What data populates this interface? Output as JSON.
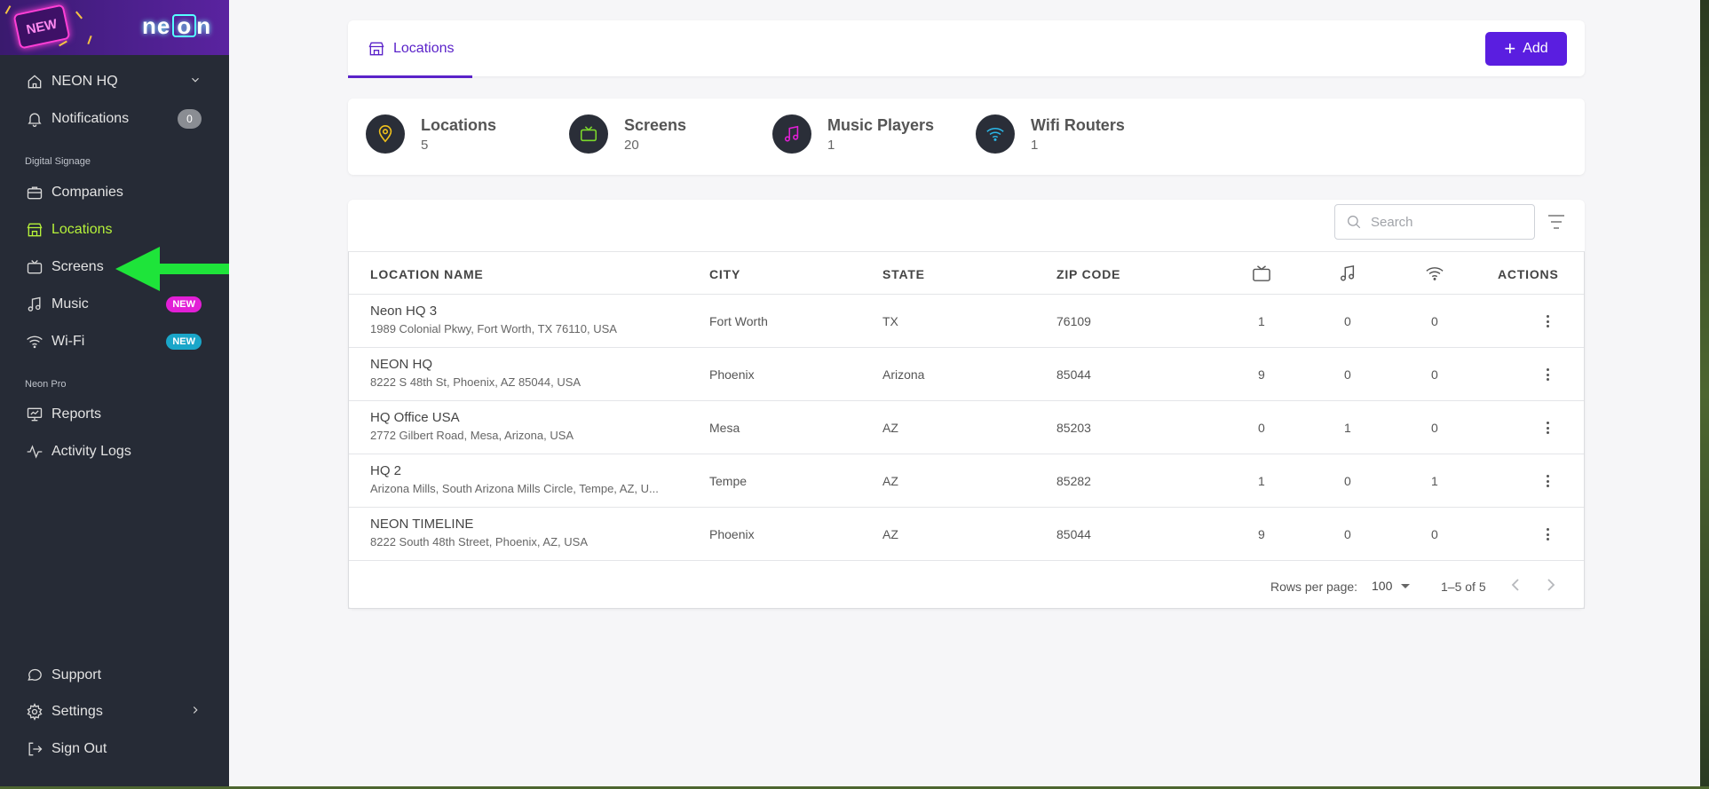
{
  "brand": {
    "badge": "NEW",
    "logo_prefix": "ne",
    "logo_o": "o",
    "logo_suffix": "n"
  },
  "sidebar": {
    "org": {
      "label": "NEON HQ"
    },
    "notifications": {
      "label": "Notifications",
      "count": "0"
    },
    "sections": [
      {
        "label": "Digital Signage"
      },
      {
        "label": "Neon Pro"
      }
    ],
    "items": [
      {
        "label": "Companies"
      },
      {
        "label": "Locations"
      },
      {
        "label": "Screens"
      },
      {
        "label": "Music",
        "badge": "NEW",
        "badge_color": "#e21fd6"
      },
      {
        "label": "Wi-Fi",
        "badge": "NEW",
        "badge_color": "#1aa6c9"
      },
      {
        "label": "Reports"
      },
      {
        "label": "Activity Logs"
      }
    ],
    "bottom": [
      {
        "label": "Support"
      },
      {
        "label": "Settings"
      },
      {
        "label": "Sign Out"
      }
    ],
    "active_color": "#b6f23a",
    "arrow_color": "#1ee43a"
  },
  "header": {
    "tab": {
      "label": "Locations"
    },
    "add_button": {
      "label": "Add"
    },
    "accent": "#5a1ee0"
  },
  "stats": [
    {
      "label": "Locations",
      "value": "5",
      "icon": "pin-icon",
      "color": "#f2c21b"
    },
    {
      "label": "Screens",
      "value": "20",
      "icon": "tv-icon",
      "color": "#7cd92b"
    },
    {
      "label": "Music Players",
      "value": "1",
      "icon": "music-icon",
      "color": "#e21fd6"
    },
    {
      "label": "Wifi Routers",
      "value": "1",
      "icon": "wifi-icon",
      "color": "#2ab8e8"
    }
  ],
  "search": {
    "placeholder": "Search",
    "value": ""
  },
  "table": {
    "columns": {
      "name": "LOCATION NAME",
      "city": "CITY",
      "state": "STATE",
      "zip": "ZIP CODE",
      "screens_icon": "tv-icon",
      "music_icon": "music-icon",
      "wifi_icon": "wifi-icon",
      "actions": "ACTIONS"
    },
    "rows": [
      {
        "name": "Neon HQ 3",
        "address": "1989 Colonial Pkwy, Fort Worth, TX 76110, USA",
        "city": "Fort Worth",
        "state": "TX",
        "zip": "76109",
        "screens": "1",
        "music": "0",
        "wifi": "0"
      },
      {
        "name": "NEON HQ",
        "address": "8222 S 48th St, Phoenix, AZ 85044, USA",
        "city": "Phoenix",
        "state": "Arizona",
        "zip": "85044",
        "screens": "9",
        "music": "0",
        "wifi": "0"
      },
      {
        "name": "HQ Office USA",
        "address": "2772 Gilbert Road, Mesa, Arizona, USA",
        "city": "Mesa",
        "state": "AZ",
        "zip": "85203",
        "screens": "0",
        "music": "1",
        "wifi": "0"
      },
      {
        "name": "HQ 2",
        "address": "Arizona Mills, South Arizona Mills Circle, Tempe, AZ, U...",
        "city": "Tempe",
        "state": "AZ",
        "zip": "85282",
        "screens": "1",
        "music": "0",
        "wifi": "1"
      },
      {
        "name": "NEON TIMELINE",
        "address": "8222 South 48th Street, Phoenix, AZ, USA",
        "city": "Phoenix",
        "state": "AZ",
        "zip": "85044",
        "screens": "9",
        "music": "0",
        "wifi": "0"
      }
    ]
  },
  "pagination": {
    "rows_per_page_label": "Rows per page:",
    "rows_per_page": "100",
    "range": "1–5 of 5"
  }
}
